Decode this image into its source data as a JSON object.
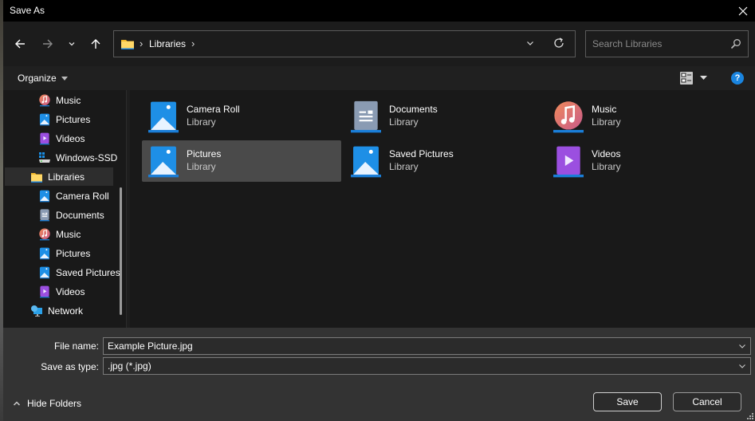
{
  "window": {
    "title": "Save As",
    "close_icon": "close-icon"
  },
  "nav": {
    "back_icon": "arrow-left-icon",
    "forward_icon": "arrow-right-icon",
    "recent_icon": "chevron-down-icon",
    "up_icon": "arrow-up-icon",
    "breadcrumb": [
      "Libraries"
    ],
    "refresh_icon": "refresh-icon",
    "search_placeholder": "Search Libraries",
    "search_value": ""
  },
  "command_bar": {
    "organize_label": "Organize",
    "view_icon": "view-options-icon",
    "help_label": "?"
  },
  "sidebar": {
    "items": [
      {
        "label": "Music",
        "icon": "music",
        "indent": 1
      },
      {
        "label": "Pictures",
        "icon": "pictures",
        "indent": 1
      },
      {
        "label": "Videos",
        "icon": "videos",
        "indent": 1
      },
      {
        "label": "Windows-SSD",
        "icon": "drive",
        "indent": 1
      },
      {
        "label": "Libraries",
        "icon": "folder",
        "indent": 0,
        "selected": true
      },
      {
        "label": "Camera Roll",
        "icon": "pictures",
        "indent": 1
      },
      {
        "label": "Documents",
        "icon": "documents",
        "indent": 1
      },
      {
        "label": "Music",
        "icon": "music",
        "indent": 1
      },
      {
        "label": "Pictures",
        "icon": "pictures",
        "indent": 1
      },
      {
        "label": "Saved Pictures",
        "icon": "pictures",
        "indent": 1
      },
      {
        "label": "Videos",
        "icon": "videos",
        "indent": 1
      },
      {
        "label": "Network",
        "icon": "network",
        "indent": 0
      }
    ]
  },
  "libraries": [
    {
      "name": "Camera Roll",
      "type": "Library",
      "icon": "pictures"
    },
    {
      "name": "Documents",
      "type": "Library",
      "icon": "documents"
    },
    {
      "name": "Music",
      "type": "Library",
      "icon": "music"
    },
    {
      "name": "Pictures",
      "type": "Library",
      "icon": "pictures",
      "selected": true
    },
    {
      "name": "Saved Pictures",
      "type": "Library",
      "icon": "pictures"
    },
    {
      "name": "Videos",
      "type": "Library",
      "icon": "videos"
    }
  ],
  "footer": {
    "filename_label": "File name:",
    "filename_value": "Example Picture.jpg",
    "savetype_label": "Save as type:",
    "savetype_value": ".jpg (*.jpg)",
    "hide_folders_label": "Hide Folders",
    "save_label": "Save",
    "cancel_label": "Cancel"
  },
  "colors": {
    "accent": "#1a85e0",
    "titlebar": "#000000",
    "content_bg": "#191919",
    "footer_bg": "#333333",
    "selection": "#4a4a4a"
  }
}
